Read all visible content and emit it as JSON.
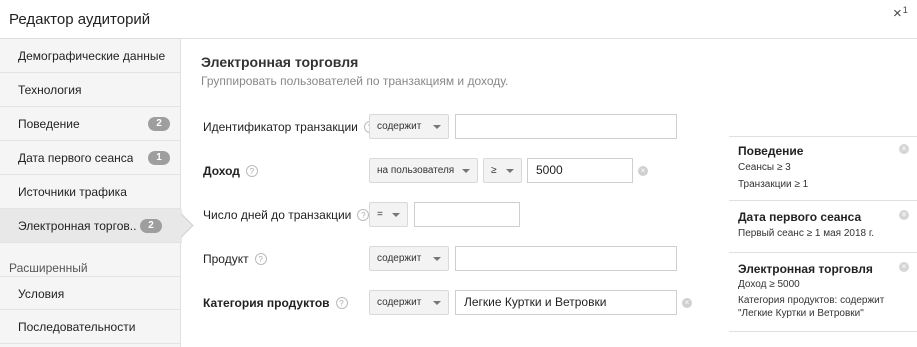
{
  "header": {
    "title": "Редактор аудиторий",
    "close_icon": "×",
    "close_sup": "1"
  },
  "sidebar": {
    "items": [
      {
        "label": "Демографические данные",
        "badge": ""
      },
      {
        "label": "Технология",
        "badge": ""
      },
      {
        "label": "Поведение",
        "badge": "2"
      },
      {
        "label": "Дата первого сеанса",
        "badge": "1"
      },
      {
        "label": "Источники трафика",
        "badge": ""
      },
      {
        "label": "Электронная торгов...",
        "badge": "2"
      }
    ],
    "advanced_label": "Расширенный",
    "advanced_items": [
      {
        "label": "Условия"
      },
      {
        "label": "Последовательности"
      }
    ]
  },
  "main": {
    "title": "Электронная торговля",
    "subtitle": "Группировать пользователей по транзакциям и доходу.",
    "help_glyph": "?",
    "clear_glyph": "×",
    "rows": {
      "transaction_id": {
        "label": "Идентификатор транзакции",
        "operator": "содержит",
        "value": ""
      },
      "revenue": {
        "label": "Доход",
        "scope": "на пользователя",
        "operator": "≥",
        "value": "5000"
      },
      "days_to_transaction": {
        "label": "Число дней до транзакции",
        "operator": "=",
        "value": ""
      },
      "product": {
        "label": "Продукт",
        "operator": "содержит",
        "value": ""
      },
      "product_category": {
        "label": "Категория продуктов",
        "operator": "содержит",
        "value": "Легкие Куртки и Ветровки"
      }
    }
  },
  "summary": {
    "cards": [
      {
        "title": "Поведение",
        "lines": [
          "Сеансы ≥ 3",
          "Транзакции ≥ 1"
        ]
      },
      {
        "title": "Дата первого сеанса",
        "lines": [
          "Первый сеанс ≥ 1 мая 2018 г."
        ]
      },
      {
        "title": "Электронная торговля",
        "lines": [
          "Доход ≥ 5000",
          "Категория продуктов: содержит",
          "\"Легкие Куртки и Ветровки\""
        ]
      }
    ]
  }
}
